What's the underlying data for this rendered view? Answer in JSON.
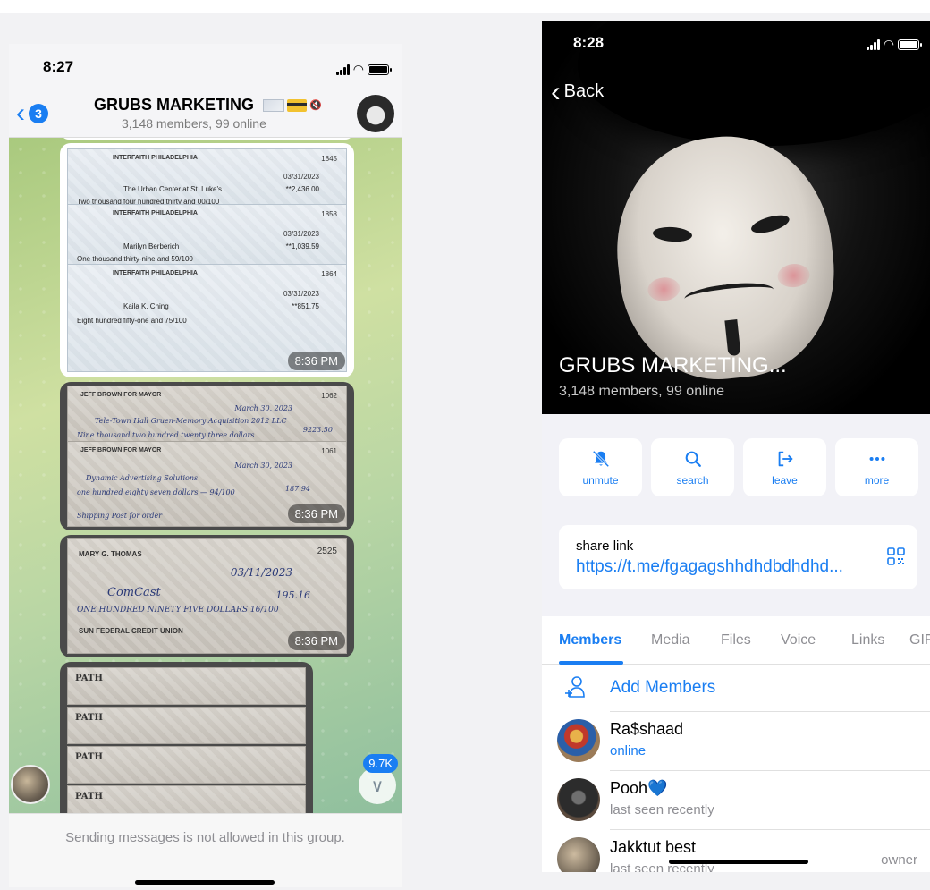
{
  "left_phone": {
    "status": {
      "time": "8:27"
    },
    "header": {
      "back_count": "3",
      "title": "GRUBS MARKETING",
      "subtitle": "3,148 members, 99 online"
    },
    "messages": [
      {
        "time": "8:36 PM"
      },
      {
        "time": "8:36 PM"
      },
      {
        "time": "8:36 PM"
      }
    ],
    "checks": {
      "interfaith": [
        {
          "bank": "INTERFAITH PHILADELPHIA",
          "number": "1845",
          "payee": "The Urban Center at St. Luke's",
          "amount": "**2,436.00",
          "words": "Two thousand four hundred thirty and 00/100",
          "date": "03/31/2023"
        },
        {
          "bank": "INTERFAITH PHILADELPHIA",
          "number": "1858",
          "payee": "Marilyn Berberich",
          "amount": "**1,039.59",
          "words": "One thousand thirty-nine and 59/100",
          "date": "03/31/2023"
        },
        {
          "bank": "INTERFAITH PHILADELPHIA",
          "number": "1864",
          "payee": "Kaila K. Ching",
          "amount": "**851.75",
          "words": "Eight hundred fifty-one and 75/100",
          "date": "03/31/2023"
        }
      ],
      "brown": [
        {
          "bank": "JEFF BROWN FOR MAYOR",
          "number": "1062",
          "payee": "Tele-Town Hall Gruen-Memory Acquisition 2012 LLC",
          "amount": "9223.50",
          "words": "Nine thousand two hundred twenty three dollars",
          "date": "March 30, 2023"
        },
        {
          "bank": "JEFF BROWN FOR MAYOR",
          "number": "1061",
          "payee": "Dynamic Advertising Solutions",
          "amount": "187.94",
          "words": "one hundred eighty seven dollars — 94/100",
          "date": "March 30, 2023",
          "memo": "Shipping Post for order"
        }
      ],
      "thomas": {
        "name": "MARY G. THOMAS",
        "number": "2525",
        "payee": "ComCast",
        "amount": "195.16",
        "words": "ONE HUNDRED NINETY FIVE DOLLARS 16/100",
        "date": "03/11/2023",
        "bank": "SUN FEDERAL CREDIT UNION"
      },
      "path": {
        "org": "PATH"
      }
    },
    "unread_badge": "9.7K",
    "footer_text": "Sending messages is not allowed in this group."
  },
  "right_phone": {
    "status": {
      "time": "8:28"
    },
    "back_label": "Back",
    "group_name": "GRUBS MARKETING...",
    "group_sub": "3,148 members, 99 online",
    "actions": [
      {
        "label": "unmute",
        "icon": "bell-slash-icon"
      },
      {
        "label": "search",
        "icon": "search-icon"
      },
      {
        "label": "leave",
        "icon": "leave-icon"
      },
      {
        "label": "more",
        "icon": "ellipsis-icon"
      }
    ],
    "share": {
      "label": "share link",
      "url": "https://t.me/fgagagshhdhdbdhdhd..."
    },
    "tabs": [
      "Members",
      "Media",
      "Files",
      "Voice",
      "Links",
      "GIFs"
    ],
    "add_members": "Add Members",
    "members": [
      {
        "name": "Ra$shaad",
        "status": "online",
        "role": ""
      },
      {
        "name": "Pooh",
        "status": "last seen recently",
        "role": "",
        "emoji": "💙"
      },
      {
        "name": "Jakktut best",
        "status": "last seen recently",
        "role": "owner"
      }
    ]
  },
  "colors": {
    "accent": "#1a7ef2",
    "secondary_text": "#8e8e93",
    "chat_bg": "#b9d6a4"
  }
}
